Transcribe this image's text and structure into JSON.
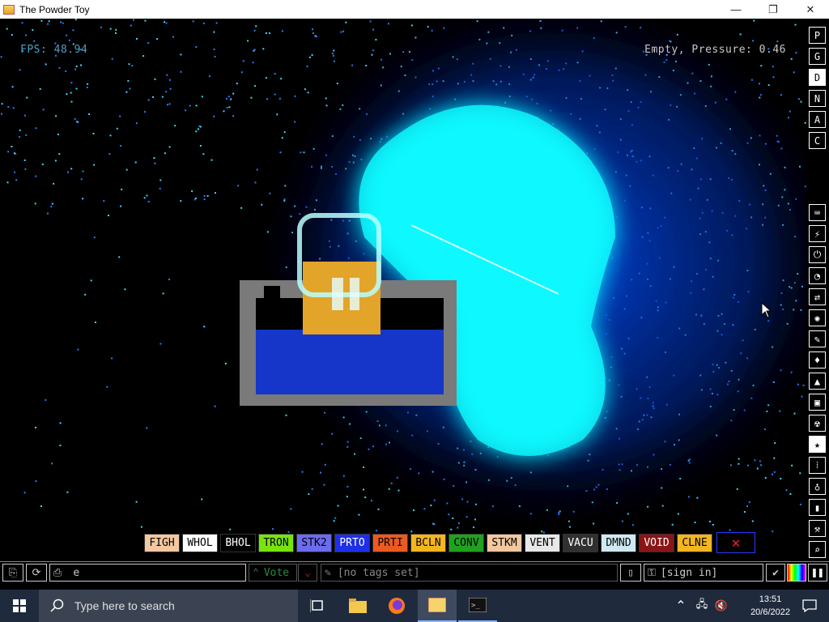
{
  "window": {
    "title": "The Powder Toy",
    "minimize": "—",
    "maximize": "❐",
    "close": "✕"
  },
  "hud": {
    "fps": "FPS: 48.94",
    "pressure": "Empty, Pressure: 0.46"
  },
  "right_panel": {
    "top_buttons": [
      "P",
      "G",
      "D",
      "N",
      "A",
      "C"
    ],
    "active": "D",
    "category_icons": [
      "keyboard-icon",
      "plug-icon",
      "power-icon",
      "gauge-icon",
      "arrows-icon",
      "sparkle-icon",
      "brush-icon",
      "drop-icon",
      "flask-icon",
      "box-icon",
      "radiation-icon",
      "star-icon",
      "dots-icon",
      "bulb-icon",
      "bookmark-icon",
      "hammer-icon",
      "search-icon"
    ]
  },
  "elements": [
    {
      "label": "FIGH",
      "bg": "#f3c7a0",
      "fg": "#000000"
    },
    {
      "label": "WHOL",
      "bg": "#ffffff",
      "fg": "#000000"
    },
    {
      "label": "BHOL",
      "bg": "#000000",
      "fg": "#ffffff"
    },
    {
      "label": "TRON",
      "bg": "#79e30e",
      "fg": "#000000"
    },
    {
      "label": "STK2",
      "bg": "#6c6cf0",
      "fg": "#000000"
    },
    {
      "label": "PRTO",
      "bg": "#1f2ee8",
      "fg": "#ffffff"
    },
    {
      "label": "PRTI",
      "bg": "#ec5a1f",
      "fg": "#000000"
    },
    {
      "label": "BCLN",
      "bg": "#f3b520",
      "fg": "#000000"
    },
    {
      "label": "CONV",
      "bg": "#1fa21f",
      "fg": "#000000"
    },
    {
      "label": "STKM",
      "bg": "#f3c7a0",
      "fg": "#000000"
    },
    {
      "label": "VENT",
      "bg": "#e8e8e8",
      "fg": "#000000"
    },
    {
      "label": "VACU",
      "bg": "#303030",
      "fg": "#ffffff"
    },
    {
      "label": "DMND",
      "bg": "#cfe9f3",
      "fg": "#000000"
    },
    {
      "label": "VOID",
      "bg": "#8a1416",
      "fg": "#ffffff"
    },
    {
      "label": "CLNE",
      "bg": "#f3b520",
      "fg": "#000000"
    }
  ],
  "elements_close": "✕",
  "bottom_bar": {
    "save_name": "e",
    "vote": "Vote",
    "tags": "[no tags set]",
    "sign_in": "[sign in]"
  },
  "taskbar": {
    "search_placeholder": "Type here to search",
    "time": "13:51",
    "date": "20/6/2022"
  }
}
